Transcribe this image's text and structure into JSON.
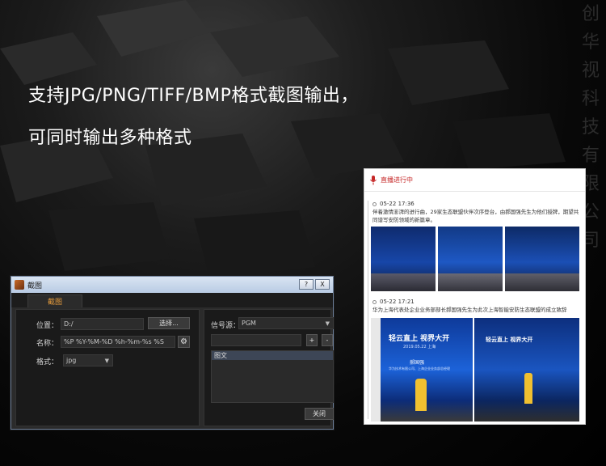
{
  "headline": {
    "line1": "支持JPG/PNG/TIFF/BMP格式截图输出，",
    "line2": "可同时输出多种格式"
  },
  "vertical_brand": [
    "创",
    "华",
    "视",
    "科",
    "技",
    "有",
    "限",
    "公",
    "司"
  ],
  "dialog": {
    "title": "截图",
    "help_btn": "?",
    "close_btn": "X",
    "tab": "截图",
    "location_label": "位置：",
    "location_value": "D:/",
    "browse_button": "选择...",
    "name_label": "名称：",
    "name_value": "%P %Y-%M-%D %h-%m-%s %S",
    "format_label": "格式：",
    "format_value": "jpg",
    "source_label": "信号源：",
    "source_value": "PGM",
    "add_btn": "+",
    "remove_btn": "-",
    "list_item": "图文",
    "close_button": "关闭"
  },
  "panel": {
    "header": "直播进行中",
    "entry1_time": "05-22 17:36",
    "entry1_text": "伴着激情澎湃的进行曲，29家生态联盟伙伴次序登台，由郝国强先生为他们授牌，期望共同谱写安防领域的新篇章。",
    "entry2_time": "05-22 17:21",
    "entry2_text": "华为上海代表处企业业务部部长郝国强先生为此次上海智能安防生态联盟的成立致辞",
    "slide_title": "轻云直上  视界大开",
    "slide_date": "2019.05.22 上海",
    "slide_speaker": "郝国强",
    "slide_company": "华为技术有限公司、上海企业业务部总经理",
    "slide2_title": "轻云直上  视界大开"
  }
}
